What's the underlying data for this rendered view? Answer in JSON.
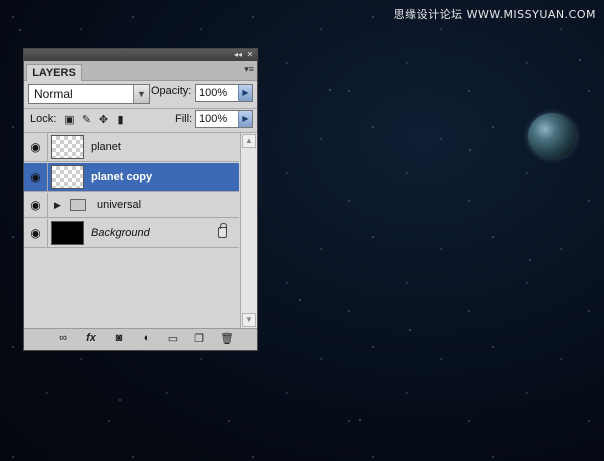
{
  "watermark": "思缘设计论坛 WWW.MISSYUAN.COM",
  "panel": {
    "tab_label": "LAYERS",
    "blend_mode": "Normal",
    "opacity_label": "Opacity:",
    "opacity_value": "100%",
    "lock_label": "Lock:",
    "fill_label": "Fill:",
    "fill_value": "100%"
  },
  "layers": [
    {
      "name": "planet",
      "thumb": "transparent",
      "selected": false
    },
    {
      "name": "planet copy",
      "thumb": "transparent",
      "selected": true
    },
    {
      "name": "universal",
      "thumb": "folder",
      "selected": false
    },
    {
      "name": "Background",
      "thumb": "black",
      "selected": false,
      "locked": true
    }
  ],
  "colors": {
    "selection": "#3d6ab7",
    "panel_bg": "#d4d4d4",
    "space_bg": "#050a14"
  }
}
